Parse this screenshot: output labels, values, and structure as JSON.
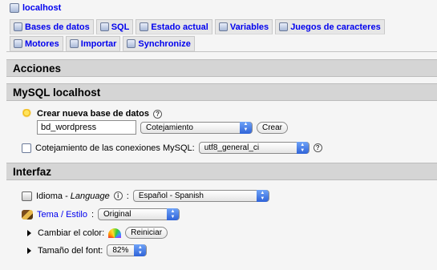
{
  "server": {
    "name": "localhost"
  },
  "tabs": [
    {
      "label": "Bases de datos",
      "icon": "databases-icon"
    },
    {
      "label": "SQL",
      "icon": "sql-icon"
    },
    {
      "label": "Estado actual",
      "icon": "status-icon"
    },
    {
      "label": "Variables",
      "icon": "variables-icon"
    },
    {
      "label": "Juegos de caracteres",
      "icon": "charsets-icon"
    },
    {
      "label": "Motores",
      "icon": "engines-icon"
    },
    {
      "label": "Importar",
      "icon": "import-icon"
    },
    {
      "label": "Synchronize",
      "icon": "synchronize-icon"
    }
  ],
  "sections": {
    "acciones": "Acciones",
    "mysql": "MySQL localhost",
    "interfaz": "Interfaz"
  },
  "create_db": {
    "label": "Crear nueva base de datos",
    "db_name_value": "bd_wordpress",
    "collation_value": "Cotejamiento",
    "button": "Crear"
  },
  "connection_collation": {
    "label": "Cotejamiento de las conexiones MySQL:",
    "value": "utf8_general_ci"
  },
  "interface": {
    "language_label": "Idioma - ",
    "language_label_italic": "Language",
    "language_value": "Español - Spanish",
    "theme_label": "Tema / Estilo",
    "theme_value": "Original",
    "color_label": "Cambiar el color:",
    "reset_button": "Reiniciar",
    "font_label": "Tamaño del font:",
    "font_value": "82%"
  },
  "colors": {
    "link": "#0000ee",
    "section_header": "#d5d5d5",
    "select_accent": "#3b73e0"
  }
}
